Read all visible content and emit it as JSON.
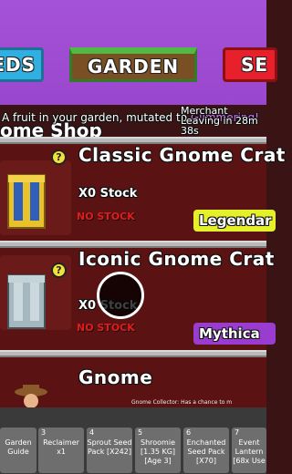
{
  "top_nav": {
    "seeds_label": "EDS",
    "garden_label": "GARDEN",
    "sell_label": "SE"
  },
  "notification": {
    "text_prefix": "A fruit in your garden, mutated to ",
    "mutation": "Glimmering!"
  },
  "merchant": {
    "line1": "Merchant",
    "line2": "Leaving in 28m",
    "line3": "38s"
  },
  "shop": {
    "title": "ome Shop",
    "items": [
      {
        "name": "Classic Gnome Crat",
        "stock": "X0 Stock",
        "status": "NO STOCK",
        "rarity": "Legendar",
        "rarity_color": "#e4f028",
        "crate_color": "#e8c12b"
      },
      {
        "name": "Iconic Gnome Crat",
        "stock": "X0 Stock",
        "status": "NO STOCK",
        "rarity": "Mythica",
        "rarity_color": "#9b3cd1",
        "crate_color": "#9fb0b7"
      },
      {
        "name": "Gnome",
        "caption": "Gnome Collector: Has a chance to m"
      }
    ],
    "badge": "?"
  },
  "hotbar": {
    "slots": [
      {
        "num": "",
        "label": "Garden Guide"
      },
      {
        "num": "3",
        "label": "Reclaimer x1"
      },
      {
        "num": "4",
        "label": "Sprout Seed Pack [X242]"
      },
      {
        "num": "5",
        "label": "Shroomie [1.35 KG] [Age 3]"
      },
      {
        "num": "6",
        "label": "Enchanted Seed Pack [X70]"
      },
      {
        "num": "7",
        "label": "Event Lantern [68x Use"
      }
    ]
  }
}
